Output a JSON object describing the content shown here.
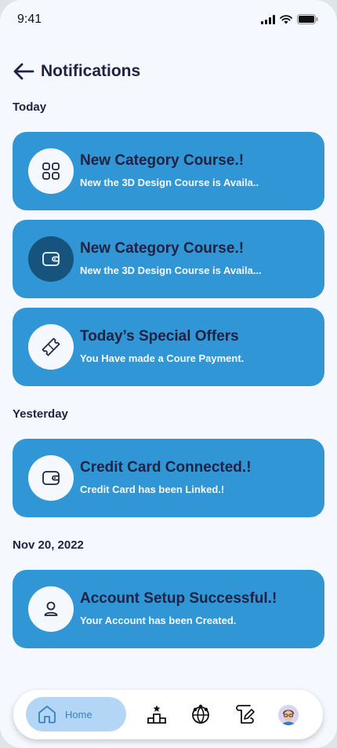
{
  "status_bar": {
    "time": "9:41"
  },
  "header": {
    "title": "Notifications"
  },
  "sections": [
    {
      "label": "Today"
    },
    {
      "label": "Yesterday"
    },
    {
      "label": "Nov 20, 2022"
    }
  ],
  "notifications": [
    {
      "icon": "category-grid-icon",
      "title": "New Category Course.!",
      "subtitle": "New the 3D Design Course is Availa.."
    },
    {
      "icon": "wallet-icon",
      "title": "New Category Course.!",
      "subtitle": "New the 3D Design Course is Availa..."
    },
    {
      "icon": "ticket-icon",
      "title": "Today’s Special Offers",
      "subtitle": "You Have made a Coure Payment."
    },
    {
      "icon": "wallet-icon",
      "title": "Credit Card Connected.!",
      "subtitle": "Credit Card has been Linked.!"
    },
    {
      "icon": "user-icon",
      "title": "Account Setup Successful.!",
      "subtitle": "Your Account has been Created."
    }
  ],
  "bottom_nav": {
    "home_label": "Home",
    "items": [
      "home-icon",
      "leaderboard-icon",
      "community-globe-icon",
      "edit-note-icon",
      "profile-avatar"
    ]
  },
  "colors": {
    "card": "#3096d6",
    "card_title": "#202244",
    "background": "#f5f9ff",
    "dark_icon_circle": "#16547e",
    "nav_active": "#b3d6f7"
  }
}
